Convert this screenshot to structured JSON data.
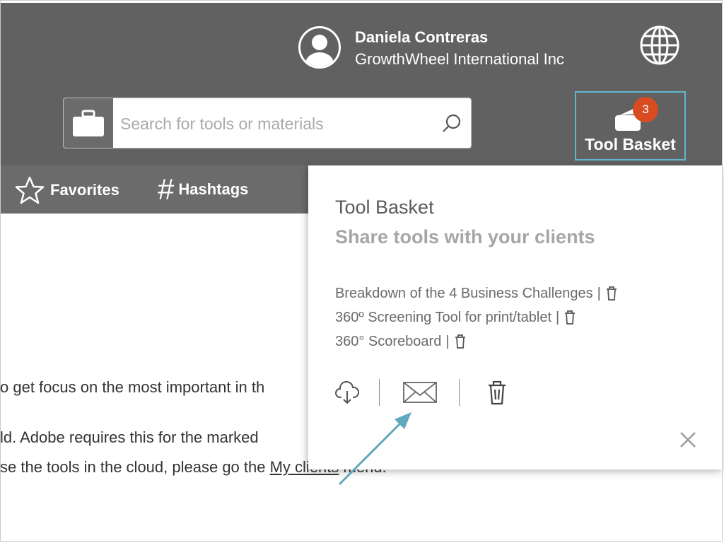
{
  "user": {
    "name": "Daniela Contreras",
    "company": "GrowthWheel International Inc"
  },
  "search": {
    "placeholder": "Search for tools or materials"
  },
  "tool_basket_button": {
    "label": "Tool Basket",
    "badge_count": "3"
  },
  "nav": {
    "items": [
      {
        "label": "Favorites"
      },
      {
        "label": "Hashtags"
      }
    ]
  },
  "body_text": {
    "line1": "o get focus on the most important in th",
    "line2": "ld. Adobe requires this for the marked",
    "line3_prefix": "se the tools in the cloud, please go the ",
    "line3_link": "My clients",
    "line3_suffix": " menu."
  },
  "popover": {
    "title": "Tool Basket",
    "subtitle": "Share tools with your clients",
    "items": [
      {
        "label": "Breakdown of the 4 Business Challenges"
      },
      {
        "label": "360º Screening Tool for print/tablet"
      },
      {
        "label": "360° Scoreboard"
      }
    ],
    "separator": "|"
  },
  "colors": {
    "header": "#616161",
    "nav": "#6b6b6b",
    "badge": "#d94c22",
    "highlight": "#5fb6d1",
    "annotation_arrow": "#5fa8bf"
  }
}
